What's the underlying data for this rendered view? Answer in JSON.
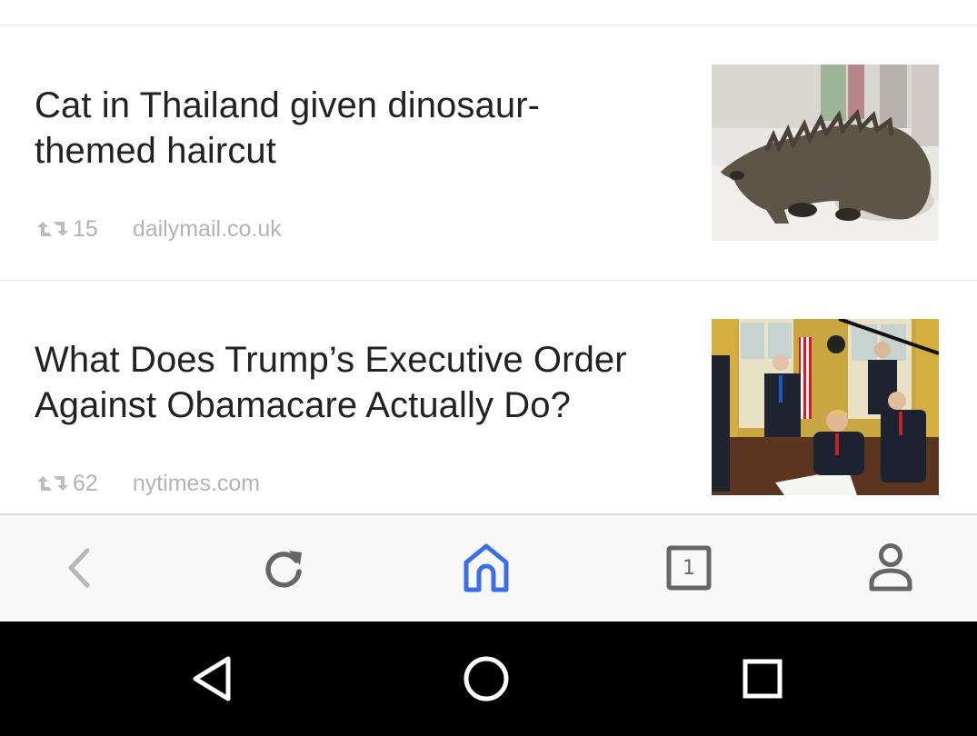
{
  "feed": {
    "items": [
      {
        "headline": "Cat in Thailand given dinosaur-themed haircut",
        "headline_lines": [
          "Cat in Thailand given dinosaur-",
          "themed haircut"
        ],
        "retweet_count": "15",
        "source": "dailymail.co.uk",
        "thumbnail_icon": "dinosaur-cat-photo"
      },
      {
        "headline": "What Does Trump’s Executive Order Against Obamacare Actually Do?",
        "headline_lines": [
          "What Does Trump’s Executive Order",
          "Against Obamacare Actually Do?"
        ],
        "retweet_count": "62",
        "source": "nytimes.com",
        "thumbnail_icon": "oval-office-signing-photo"
      }
    ]
  },
  "toolbar": {
    "back_icon": "chevron-left-icon",
    "reload_icon": "reload-icon",
    "home_icon": "home-icon",
    "tabs_icon": "tabs-icon",
    "tab_count": "1",
    "profile_icon": "person-icon",
    "accent_color": "#3b6ee8",
    "icon_color": "#666666",
    "disabled_color": "#b8b8b8"
  },
  "system_nav": {
    "back_icon": "triangle-back-icon",
    "home_icon": "circle-home-icon",
    "recents_icon": "square-recents-icon"
  }
}
